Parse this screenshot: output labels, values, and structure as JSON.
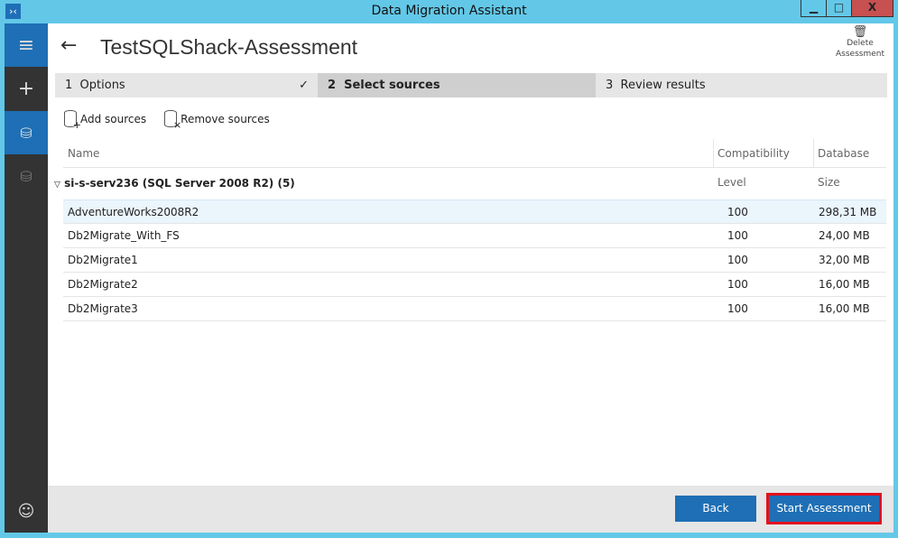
{
  "window": {
    "title": "Data Migration Assistant",
    "min": "▁",
    "max": "□",
    "close": "X"
  },
  "page": {
    "title": "TestSQLShack-Assessment",
    "delete_label": "Delete\nAssessment",
    "delete_l1": "Delete",
    "delete_l2": "Assessment"
  },
  "steps": [
    {
      "num": "1",
      "label": "Options"
    },
    {
      "num": "2",
      "label": "Select sources"
    },
    {
      "num": "3",
      "label": "Review results"
    }
  ],
  "toolbar": {
    "add": "Add sources",
    "remove": "Remove sources"
  },
  "table": {
    "headers": [
      "Name",
      "Compatibility Level",
      "Database Size"
    ],
    "group": "si-s-serv236 (SQL Server 2008 R2) (5)",
    "rows": [
      [
        "AdventureWorks2008R2",
        "100",
        "298,31 MB"
      ],
      [
        "Db2Migrate_With_FS",
        "100",
        "24,00 MB"
      ],
      [
        "Db2Migrate1",
        "100",
        "32,00 MB"
      ],
      [
        "Db2Migrate2",
        "100",
        "16,00 MB"
      ],
      [
        "Db2Migrate3",
        "100",
        "16,00 MB"
      ]
    ]
  },
  "footer": {
    "back": "Back",
    "start": "Start Assessment"
  }
}
